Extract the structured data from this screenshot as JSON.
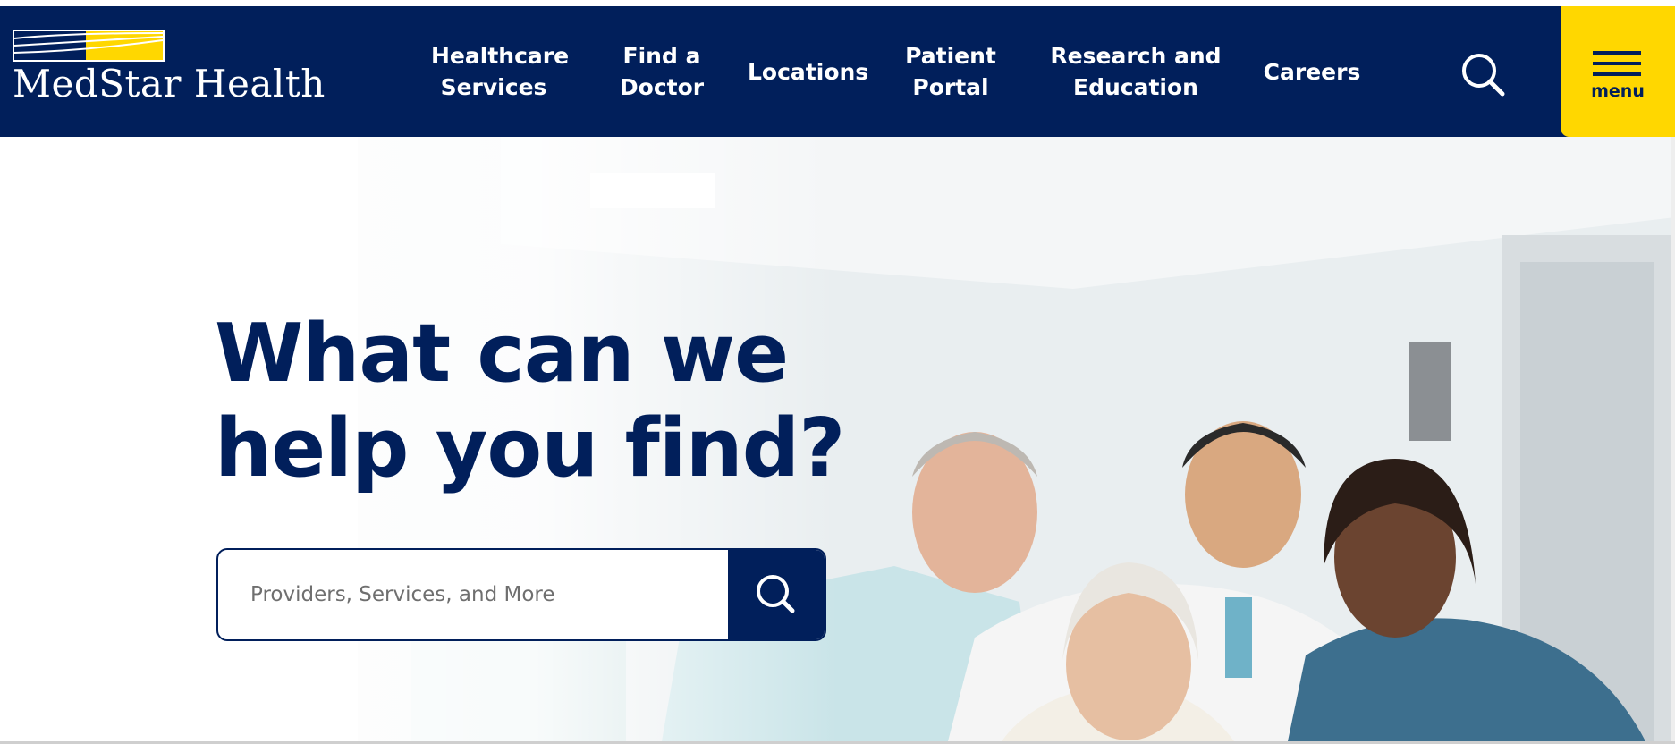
{
  "brand": {
    "name": "MedStar Health",
    "colors": {
      "navy": "#011f5b",
      "yellow": "#ffd700",
      "white": "#ffffff"
    }
  },
  "nav": {
    "items": [
      {
        "label": "Healthcare\nServices"
      },
      {
        "label": "Find a\nDoctor"
      },
      {
        "label": "Locations"
      },
      {
        "label": "Patient\nPortal"
      },
      {
        "label": "Research and\nEducation"
      },
      {
        "label": "Careers"
      }
    ],
    "search_icon": "search-icon",
    "menu_label": "menu",
    "menu_icon": "hamburger-icon"
  },
  "hero": {
    "headline": "What can we help you find?",
    "search": {
      "placeholder": "Providers, Services, and More",
      "value": "",
      "submit_icon": "search-icon"
    }
  }
}
